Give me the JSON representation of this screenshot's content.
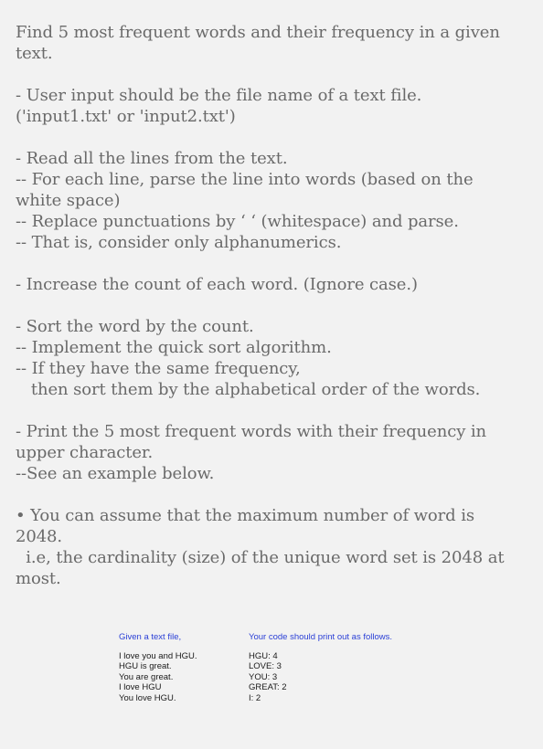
{
  "document": {
    "blocks": [
      {
        "lines": [
          "Find 5 most frequent words and their frequency in a given",
          "text."
        ]
      },
      {
        "lines": [
          "- User input should be the file name of a text file.",
          "('input1.txt' or 'input2.txt')"
        ]
      },
      {
        "lines": [
          "- Read all the lines from the text.",
          "-- For each line, parse the line into words (based on the",
          "white space)",
          "-- Replace punctuations by ‘ ‘ (whitespace) and parse.",
          "-- That is, consider only alphanumerics."
        ]
      },
      {
        "lines": [
          "- Increase the count of each word. (Ignore case.)"
        ]
      },
      {
        "lines": [
          "- Sort the word by the count.",
          "-- Implement the quick sort algorithm.",
          "-- If they have the same frequency,",
          "   then sort them by the alphabetical order of the words."
        ]
      },
      {
        "lines": [
          "- Print the 5 most frequent words with their frequency in",
          "upper character.",
          "--See an example below."
        ]
      },
      {
        "lines": [
          "• You can assume that the maximum number of word is",
          "2048.",
          "  i.e, the cardinality (size) of the unique word set is 2048 at",
          "most."
        ]
      }
    ]
  },
  "example": {
    "input_heading": "Given a text file,",
    "input_lines": [
      "I love you and HGU.",
      "HGU is great.",
      "You are great.",
      "I love HGU",
      "You love HGU."
    ],
    "output_heading": "Your code should print out as follows.",
    "output_lines": [
      "HGU: 4",
      "LOVE: 3",
      "YOU: 3",
      "GREAT: 2",
      "I: 2"
    ]
  },
  "colors": {
    "background": "#f2f2f2",
    "body_text": "#6a6a6a",
    "example_heading": "#2a3fd6",
    "example_text": "#1a1a1a"
  }
}
